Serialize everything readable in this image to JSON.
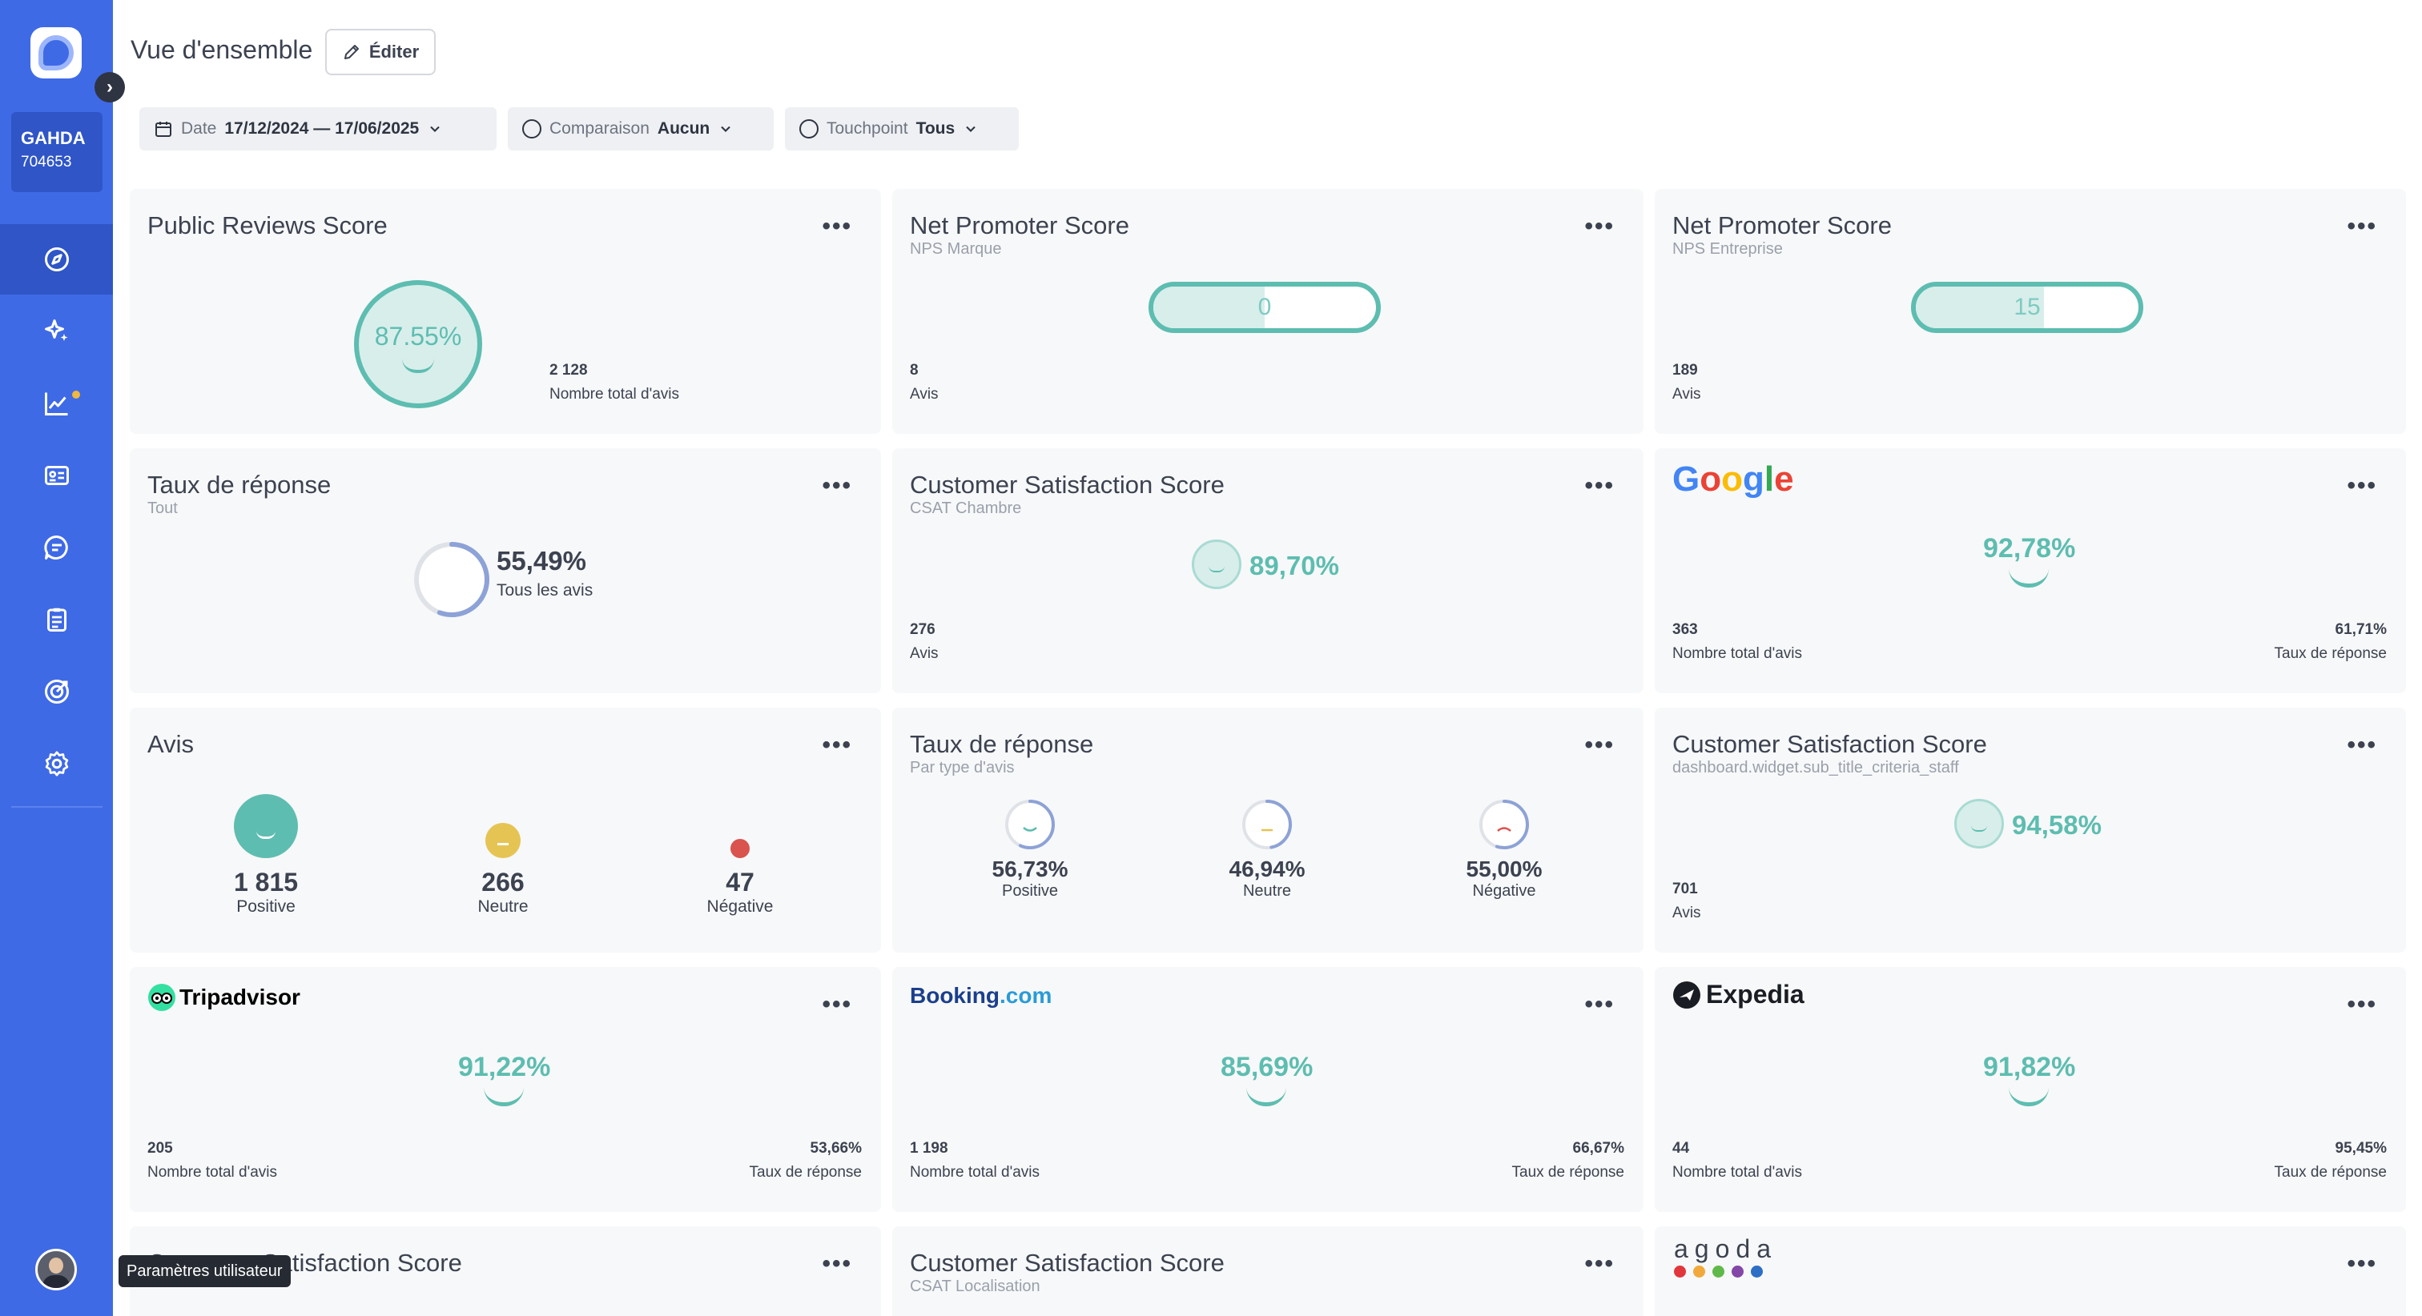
{
  "sidebar": {
    "account_name": "GAHDA",
    "account_id": "704653",
    "nav": [
      "compass-icon",
      "sparkles-icon",
      "chart-line-icon",
      "contact-card-icon",
      "chat-icon",
      "clipboard-icon",
      "target-icon",
      "settings-icon"
    ],
    "tooltip": "Paramètres utilisateur"
  },
  "header": {
    "title": "Vue d'ensemble",
    "edit_label": "Éditer",
    "filters": {
      "date_label": "Date",
      "date_value": "17/12/2024 — 17/06/2025",
      "comparison_label": "Comparaison",
      "comparison_value": "Aucun",
      "touchpoint_label": "Touchpoint",
      "touchpoint_value": "Tous"
    }
  },
  "colors": {
    "sidebar": "#3f6ae6",
    "teal": "#5dbdb0",
    "neutral": "#e5c453",
    "negative": "#d9534f"
  },
  "cards": {
    "public_reviews": {
      "title": "Public Reviews Score",
      "score": "87.55%",
      "score_value": 87.55,
      "count": "2 128",
      "count_label": "Nombre total d'avis"
    },
    "nps_marque": {
      "title": "Net Promoter Score",
      "subtitle": "NPS Marque",
      "score": "0",
      "fill_percent": 50,
      "count": "8",
      "count_label": "Avis"
    },
    "nps_entreprise": {
      "title": "Net Promoter Score",
      "subtitle": "NPS Entreprise",
      "score": "15",
      "fill_percent": 57.5,
      "count": "189",
      "count_label": "Avis"
    },
    "taux_tout": {
      "title": "Taux de réponse",
      "subtitle": "Tout",
      "score": "55,49%",
      "score_value": 55.49,
      "caption": "Tous les avis"
    },
    "csat_chambre": {
      "title": "Customer Satisfaction Score",
      "subtitle": "CSAT Chambre",
      "score": "89,70%",
      "count": "276",
      "count_label": "Avis"
    },
    "google": {
      "logo": "Google",
      "score": "92,78%",
      "count": "363",
      "count_label": "Nombre total d'avis",
      "rate": "61,71%",
      "rate_label": "Taux de réponse"
    },
    "avis": {
      "title": "Avis",
      "items": [
        {
          "count": "1 815",
          "label": "Positive"
        },
        {
          "count": "266",
          "label": "Neutre"
        },
        {
          "count": "47",
          "label": "Négative"
        }
      ]
    },
    "taux_type": {
      "title": "Taux de réponse",
      "subtitle": "Par type d'avis",
      "items": [
        {
          "score": "56,73%",
          "value": 56.73,
          "label": "Positive"
        },
        {
          "score": "46,94%",
          "value": 46.94,
          "label": "Neutre"
        },
        {
          "score": "55,00%",
          "value": 55.0,
          "label": "Négative"
        }
      ]
    },
    "csat_staff": {
      "title": "Customer Satisfaction Score",
      "subtitle": "dashboard.widget.sub_title_criteria_staff",
      "score": "94,58%",
      "count": "701",
      "count_label": "Avis"
    },
    "tripadvisor": {
      "logo": "Tripadvisor",
      "score": "91,22%",
      "count": "205",
      "count_label": "Nombre total d'avis",
      "rate": "53,66%",
      "rate_label": "Taux de réponse"
    },
    "booking": {
      "logo_main": "Booking",
      "logo_suffix": ".com",
      "score": "85,69%",
      "count": "1 198",
      "count_label": "Nombre total d'avis",
      "rate": "66,67%",
      "rate_label": "Taux de réponse"
    },
    "expedia": {
      "logo": "Expedia",
      "score": "91,82%",
      "count": "44",
      "count_label": "Nombre total d'avis",
      "rate": "95,45%",
      "rate_label": "Taux de réponse"
    },
    "csat_row5": {
      "title": "Customer Satisfaction Score"
    },
    "csat_localisation": {
      "title": "Customer Satisfaction Score",
      "subtitle": "CSAT Localisation"
    },
    "agoda": {
      "logo": "agoda"
    }
  }
}
